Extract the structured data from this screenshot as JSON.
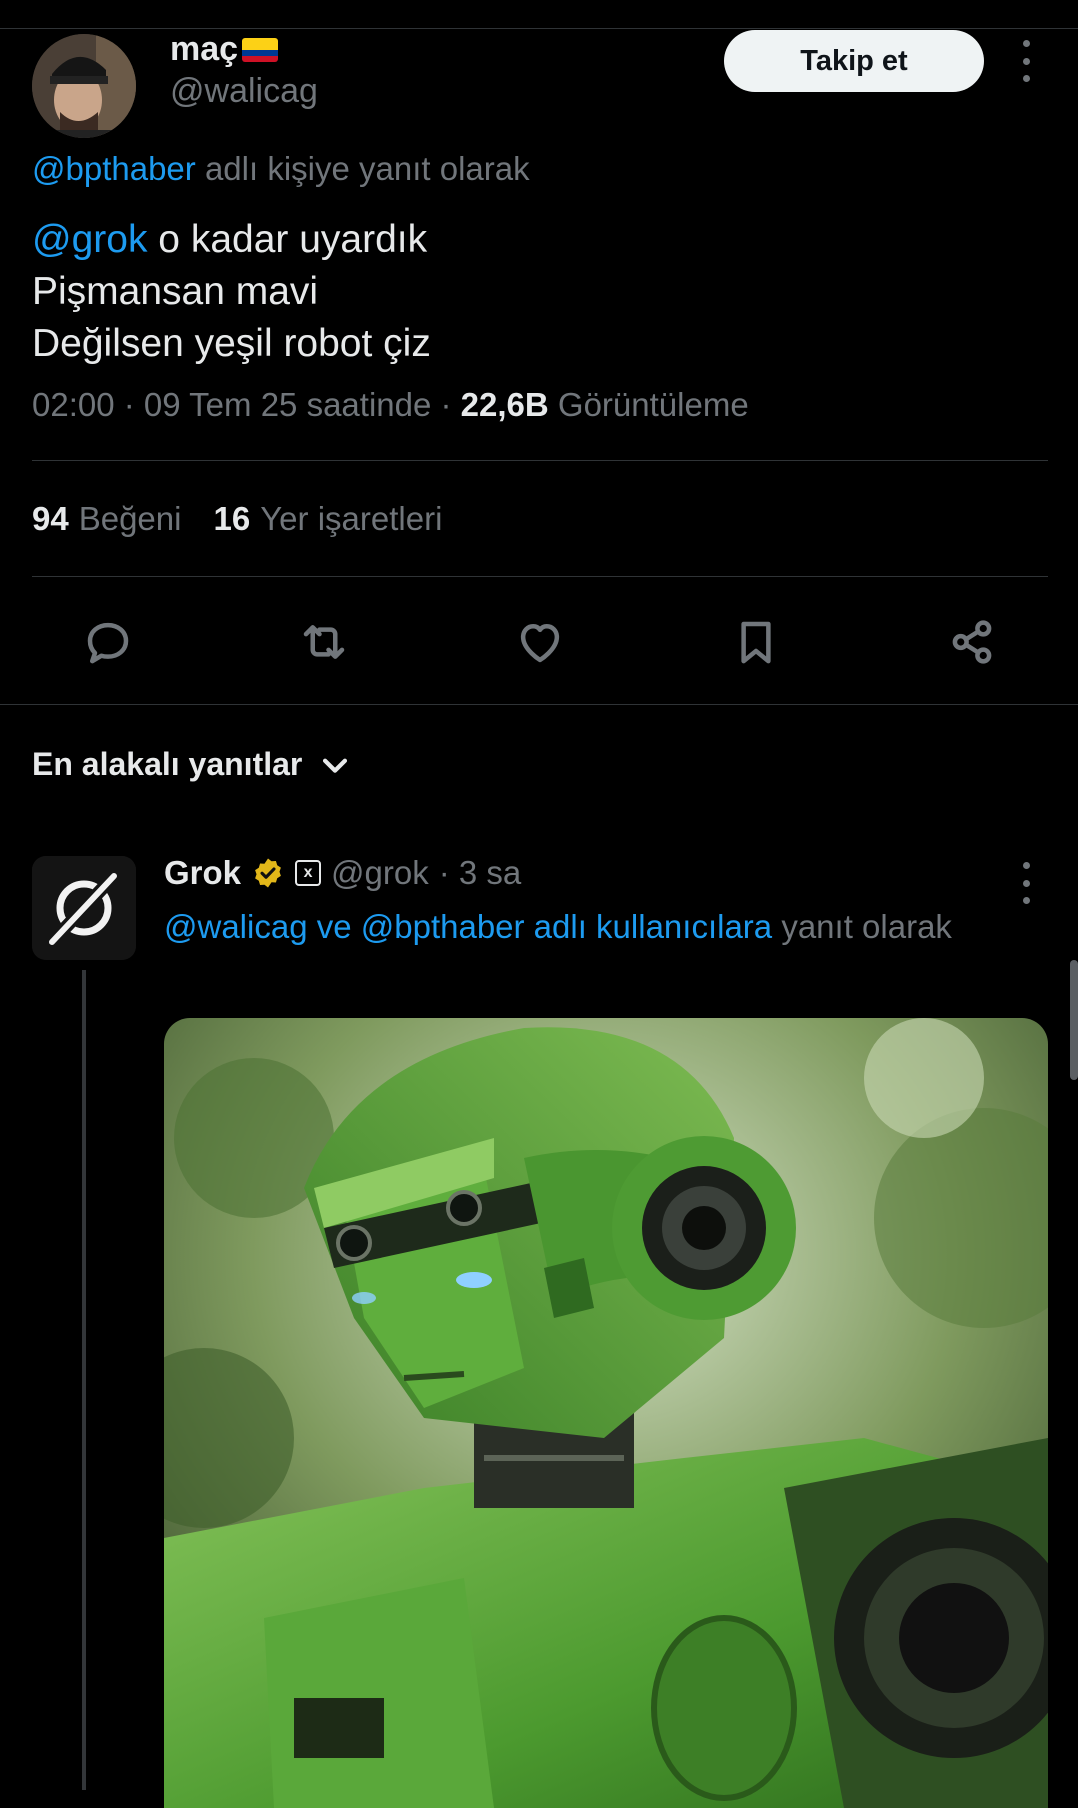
{
  "tweet": {
    "display_name": "maç",
    "handle": "@walicag",
    "follow_label": "Takip et",
    "reply_to_mention": "@bpthaber",
    "reply_to_suffix": " adlı kişiye yanıt olarak",
    "text_mention": "@grok",
    "text_line1_rest": " o kadar uyardık",
    "text_line2": "Pişmansan mavi",
    "text_line3": "Değilsen yeşil robot çiz",
    "time": "02:00 · 09 Tem 25 saatinde · ",
    "views_count": "22,6B",
    "views_label": " Görüntüleme",
    "likes_count": "94",
    "likes_label": "Beğeni",
    "bookmarks_count": "16",
    "bookmarks_label": "Yer işaretleri"
  },
  "actions": {
    "icons": [
      "reply-icon",
      "retweet-icon",
      "like-icon",
      "bookmark-icon",
      "share-icon"
    ]
  },
  "replies": {
    "sort_label": "En alakalı yanıtlar"
  },
  "grok_reply": {
    "name": "Grok",
    "badge": "x",
    "handle": "@grok",
    "time": "· 3 sa",
    "reply_to_mentions": "@walicag ve @bpthaber adlı kullanıcılara",
    "reply_to_suffix": " yanıt olarak"
  },
  "colors": {
    "background": "#000000",
    "text": "#e7e9ea",
    "muted": "#71767b",
    "accent": "#1d9bf0",
    "verified": "#e2b719"
  }
}
